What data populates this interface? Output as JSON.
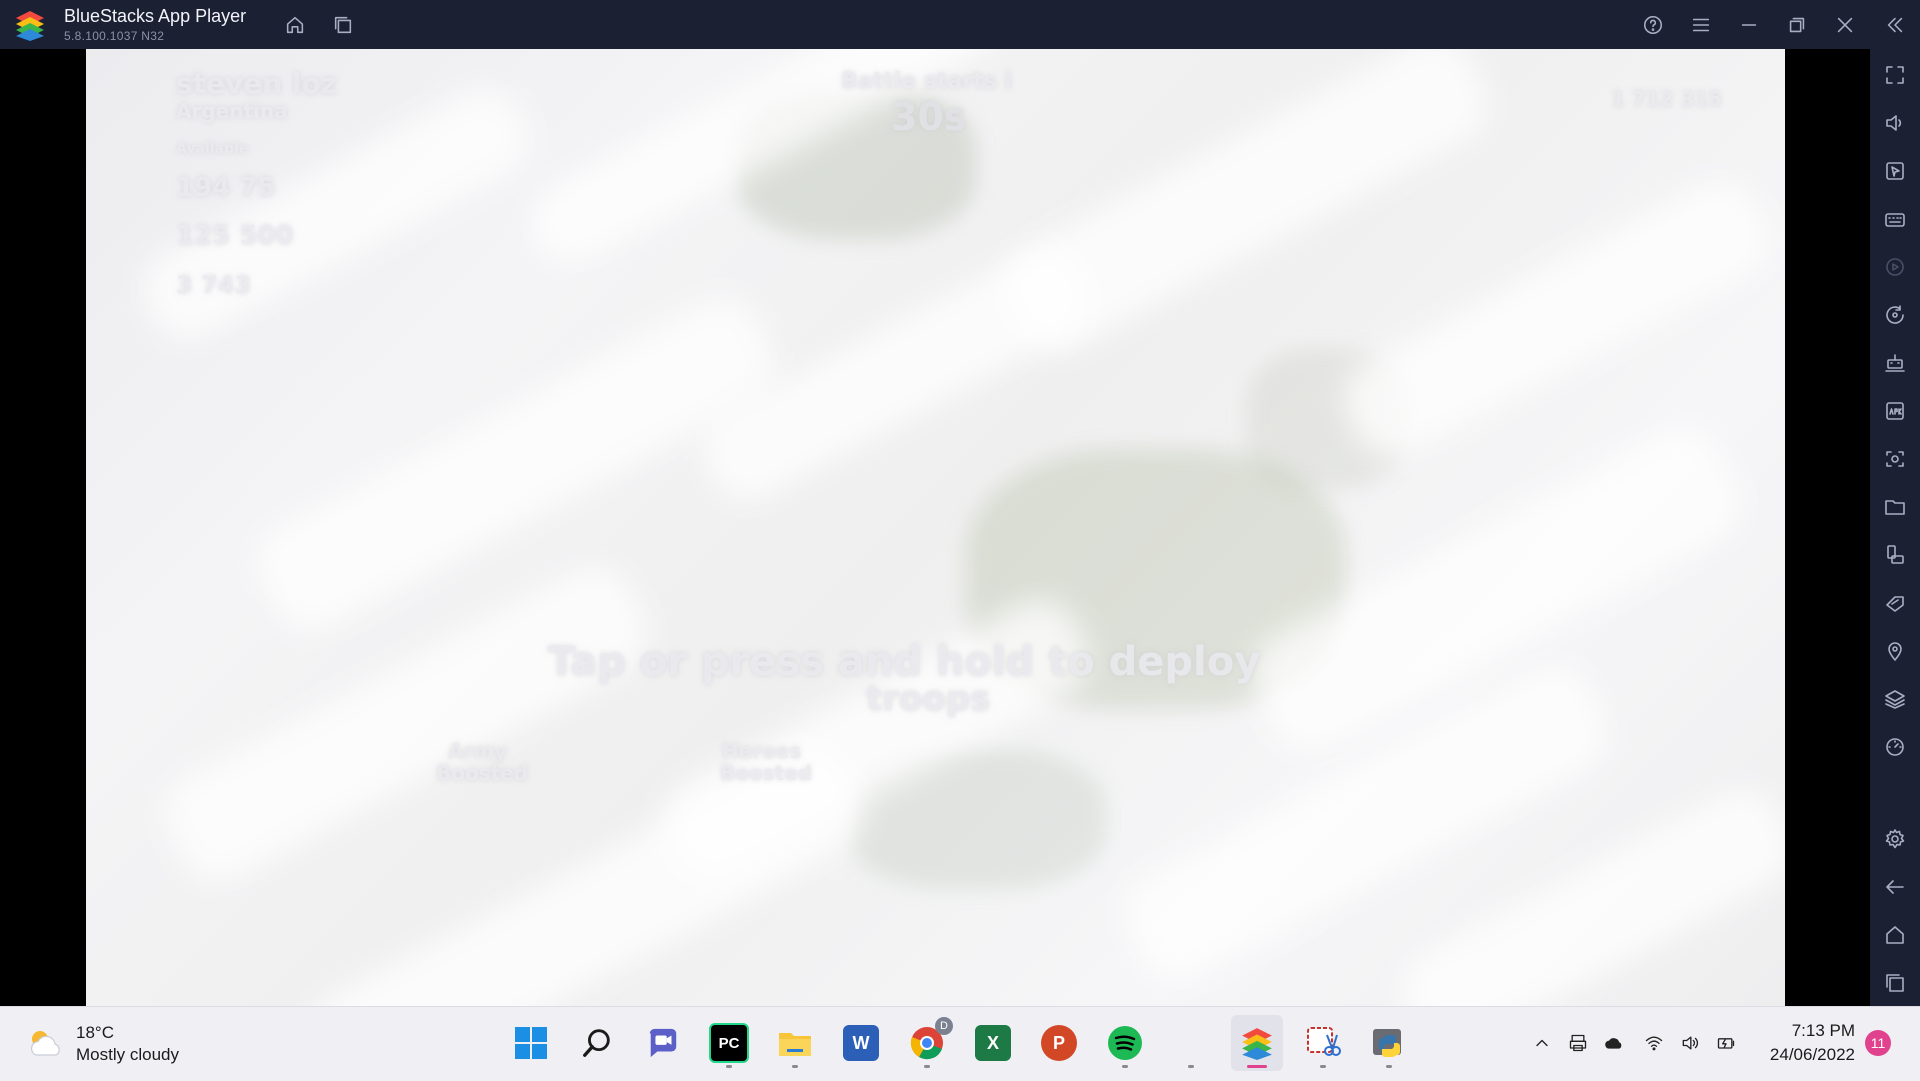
{
  "window": {
    "title": "BlueStacks App Player",
    "version": "5.8.100.1037  N32",
    "title_buttons": [
      "home-icon",
      "multi-instance-icon",
      "help-icon",
      "menu-icon",
      "minimize-icon",
      "restore-icon",
      "close-icon",
      "collapse-sidebar-icon"
    ]
  },
  "game": {
    "player_name": "steven loz",
    "player_country": "Argentina",
    "available_loot_label": "Available",
    "loot_gold": "194 75",
    "loot_elixir": "125 500",
    "loot_dark": "3 743",
    "battle_label": "Battle starts i",
    "timer": "30s",
    "trophies_right": "1 712 315",
    "deploy_hint_line1": "Tap or press and hold to deploy",
    "deploy_hint_line2": "troops",
    "army_boosted_line1": "Army",
    "army_boosted_line2": "Boosted",
    "heroes_boosted_line1": "Heroes",
    "heroes_boosted_line2": "Boosted"
  },
  "sidebar": {
    "items": [
      {
        "name": "fullscreen-icon",
        "enabled": true
      },
      {
        "name": "volume-icon",
        "enabled": true
      },
      {
        "name": "pointer-icon",
        "enabled": true
      },
      {
        "name": "keyboard-icon",
        "enabled": true
      },
      {
        "name": "record-icon",
        "enabled": false
      },
      {
        "name": "rotate-icon",
        "enabled": true
      },
      {
        "name": "macro-icon",
        "enabled": true
      },
      {
        "name": "apk-icon",
        "enabled": true
      },
      {
        "name": "screenshot-icon",
        "enabled": true
      },
      {
        "name": "folder-icon",
        "enabled": true
      },
      {
        "name": "multi-screen-icon",
        "enabled": true
      },
      {
        "name": "eco-mode-icon",
        "enabled": true
      },
      {
        "name": "location-icon",
        "enabled": true
      },
      {
        "name": "layers-icon",
        "enabled": true
      },
      {
        "name": "performance-icon",
        "enabled": true
      }
    ],
    "bottom_items": [
      {
        "name": "settings-icon"
      },
      {
        "name": "back-icon"
      },
      {
        "name": "android-home-icon"
      },
      {
        "name": "recent-apps-icon"
      }
    ]
  },
  "taskbar": {
    "weather_temp": "18°C",
    "weather_desc": "Mostly cloudy",
    "apps": [
      {
        "name": "start-icon",
        "label": ""
      },
      {
        "name": "search-icon",
        "label": ""
      },
      {
        "name": "chat-icon",
        "label": ""
      },
      {
        "name": "pycharm-icon",
        "label": "PC"
      },
      {
        "name": "file-explorer-icon",
        "label": ""
      },
      {
        "name": "word-icon",
        "label": "W"
      },
      {
        "name": "chrome-icon",
        "label": ""
      },
      {
        "name": "excel-icon",
        "label": "X"
      },
      {
        "name": "powerpoint-icon",
        "label": "P"
      },
      {
        "name": "spotify-icon",
        "label": ""
      },
      {
        "name": "bluestacks-icon",
        "label": ""
      },
      {
        "name": "snipping-tool-icon",
        "label": ""
      },
      {
        "name": "python-icon",
        "label": ""
      }
    ],
    "chrome_badge": "D",
    "time": "7:13 PM",
    "date": "24/06/2022",
    "notification_count": "11"
  }
}
